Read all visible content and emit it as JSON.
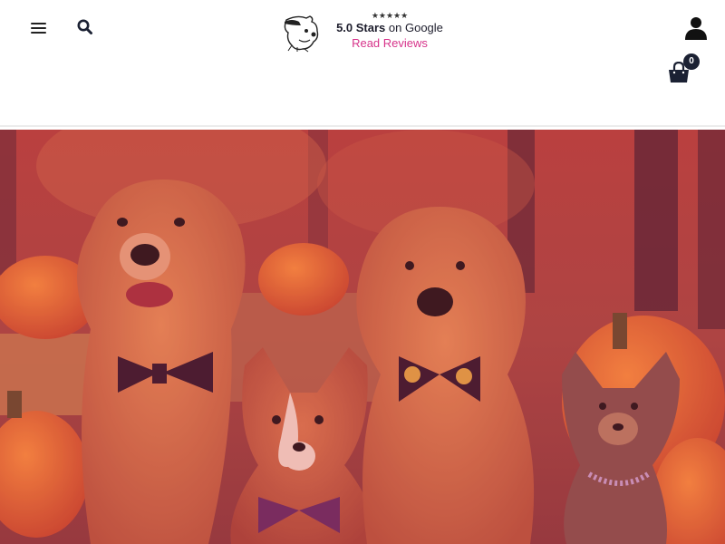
{
  "header": {
    "rating": {
      "stars": "★★★★★",
      "score": "5.0 Stars",
      "platform": "on Google",
      "reviews_link": "Read Reviews"
    },
    "cart": {
      "count": "0"
    }
  },
  "icons": {
    "menu": "hamburger-icon",
    "search": "search-icon",
    "account": "user-icon",
    "cart": "shopping-bag-icon",
    "logo": "dog-logo"
  },
  "colors": {
    "accent": "#d6338a",
    "dark": "#1b2133",
    "hero_overlay": "#c0394e"
  }
}
